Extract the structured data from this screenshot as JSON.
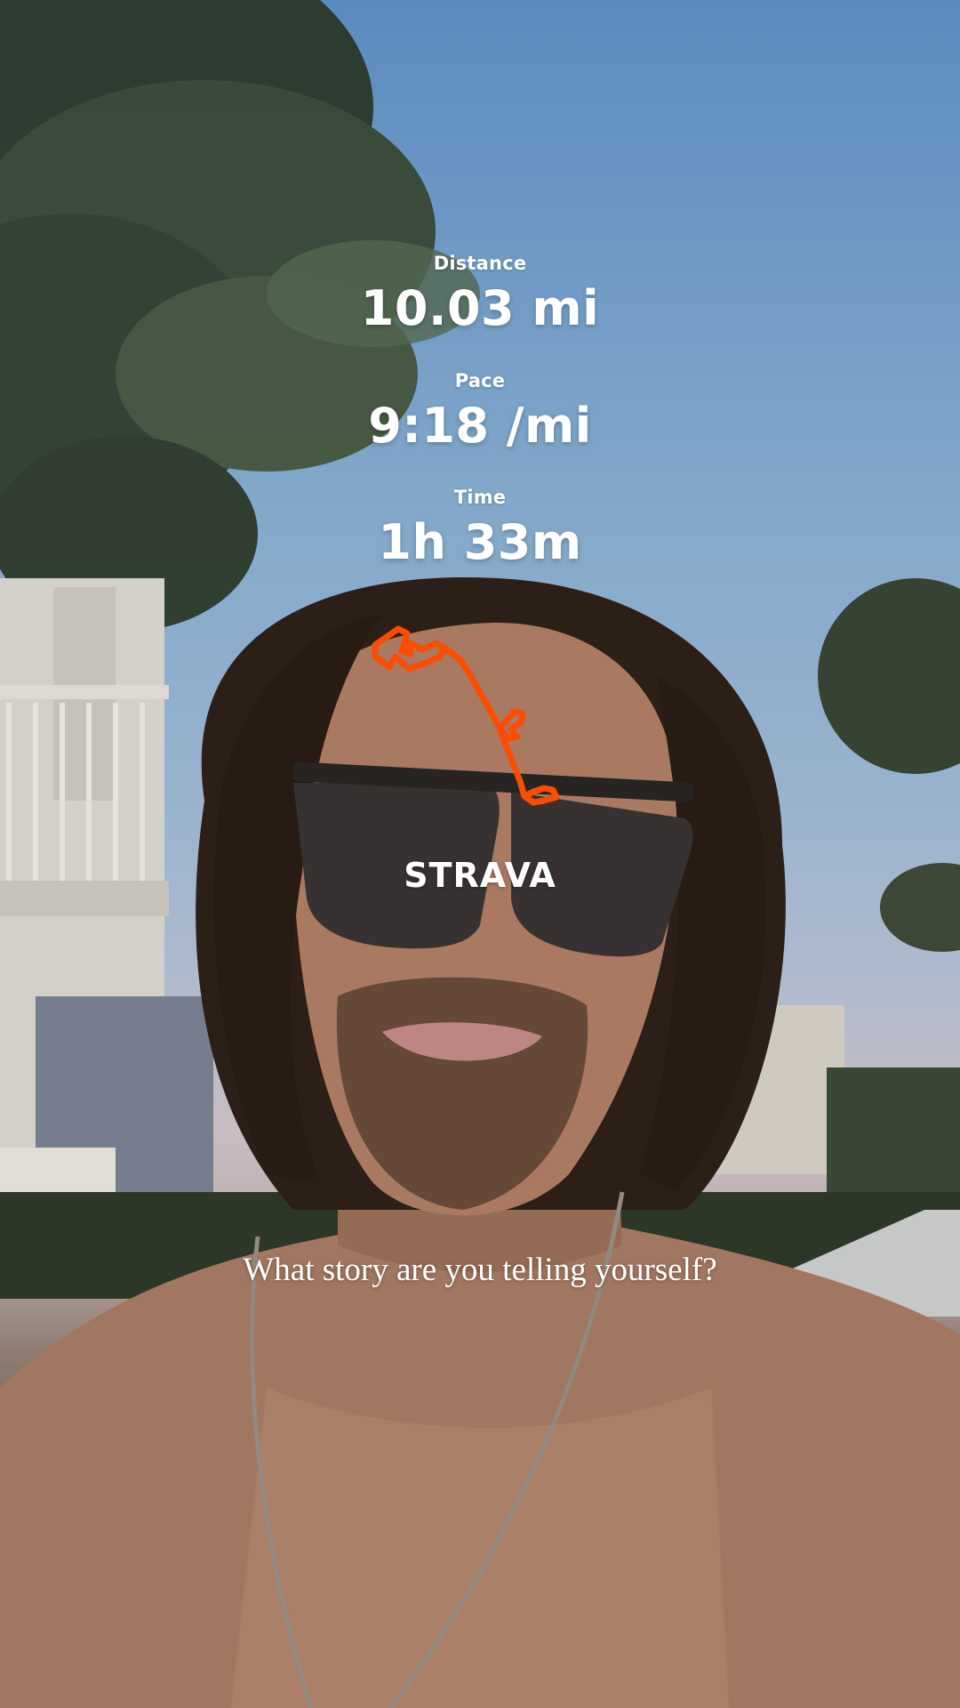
{
  "overlay": {
    "distance": {
      "label": "Distance",
      "value": "10.03 mi"
    },
    "pace": {
      "label": "Pace",
      "value": "9:18 /mi"
    },
    "time": {
      "label": "Time",
      "value": "1h 33m"
    },
    "brand": "STRAVA",
    "caption": "What story are you telling yourself?"
  },
  "colors": {
    "route": "#fc4c02",
    "text": "#ffffff"
  },
  "icons": {
    "route": "route-map-icon"
  }
}
